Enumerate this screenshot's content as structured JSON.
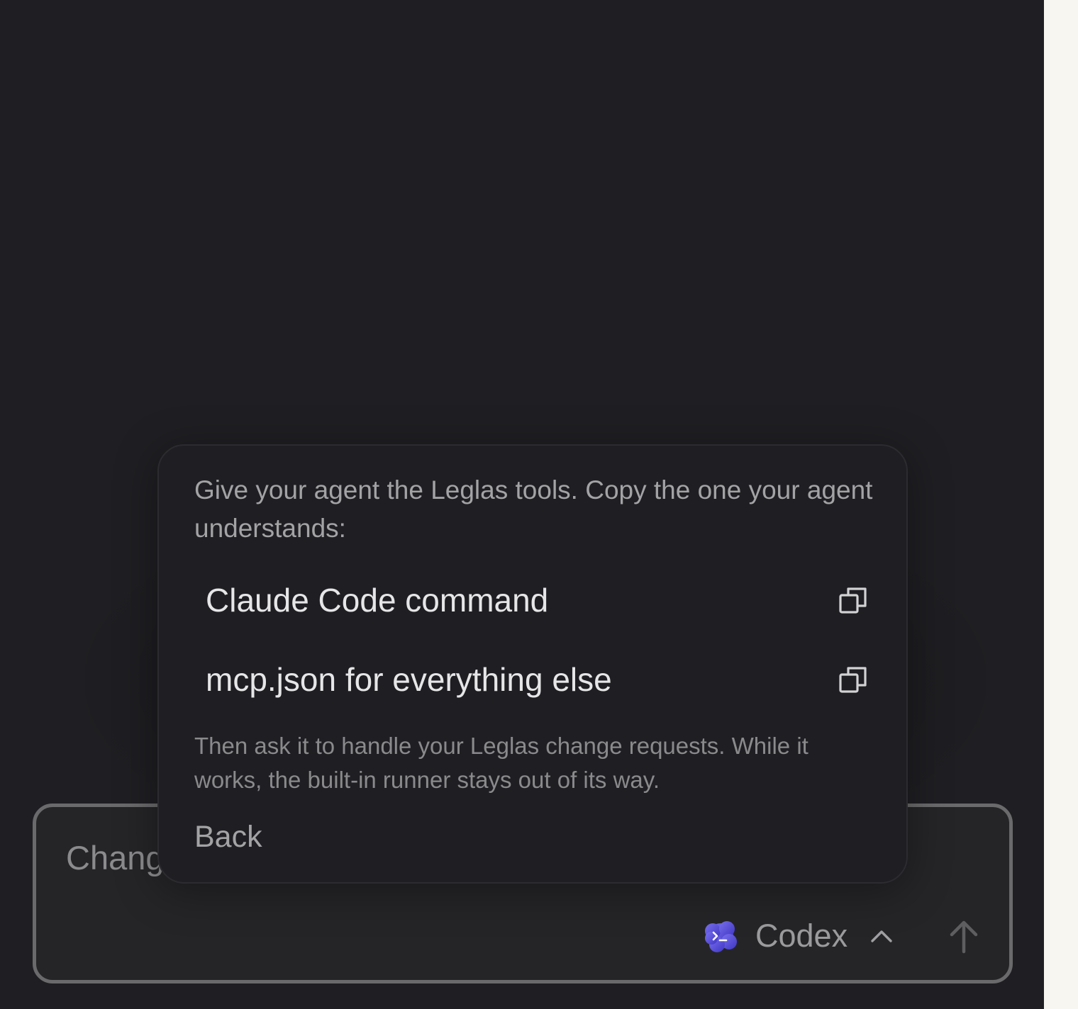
{
  "composer": {
    "input_text": "Chang",
    "agent": {
      "label": "Codex",
      "logo_icon": "codex-terminal-icon",
      "logo_color": "#5a4fd6"
    },
    "send_icon": "arrow-up-icon"
  },
  "popover": {
    "intro": "Give your agent the Leglas tools. Copy the one your agent understands:",
    "options": [
      {
        "label": "Claude Code command",
        "icon": "copy-icon"
      },
      {
        "label": "mcp.json for everything else",
        "icon": "copy-icon"
      }
    ],
    "note": "Then ask it to handle your Leglas change requests. While it works, the built-in runner stays out of its way.",
    "back_label": "Back"
  },
  "colors": {
    "background": "#1f1f23",
    "panel_border": "#2c2c30",
    "side_strip": "#f8f6f1",
    "accent": "#5a4fd6"
  }
}
